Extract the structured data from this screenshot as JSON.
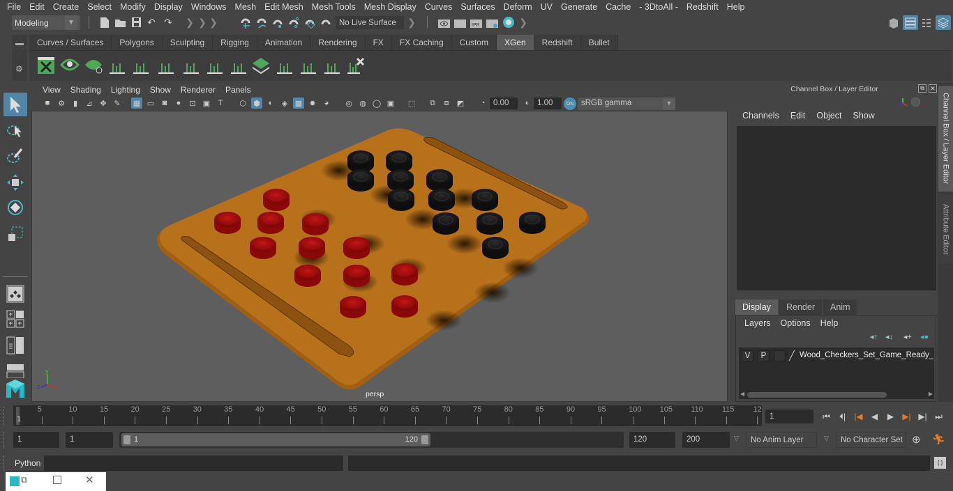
{
  "menubar": [
    "File",
    "Edit",
    "Create",
    "Select",
    "Modify",
    "Display",
    "Windows",
    "Mesh",
    "Edit Mesh",
    "Mesh Tools",
    "Mesh Display",
    "Curves",
    "Surfaces",
    "Deform",
    "UV",
    "Generate",
    "Cache",
    "- 3DtoAll -",
    "Redshift",
    "Help"
  ],
  "statusline": {
    "mode": "Modeling",
    "live_surface": "No Live Surface",
    "render_icons": [
      "render-view-icon",
      "render-current-frame-icon",
      "ipr-render-icon",
      "render-settings-icon",
      "hypershade-icon"
    ],
    "ipr_label": "IPR"
  },
  "shelf": {
    "tabs": [
      "Curves / Surfaces",
      "Polygons",
      "Sculpting",
      "Rigging",
      "Animation",
      "Rendering",
      "FX",
      "FX Caching",
      "Custom",
      "XGen",
      "Redshift",
      "Bullet"
    ],
    "active_tab": "XGen",
    "icons": [
      "xgen-editor-icon",
      "xgen-visibility-icon",
      "xgen-hide-icon",
      "xgen-add-guide-icon",
      "xgen-sculpt-guide-icon",
      "xgen-add-guide-2-icon",
      "xgen-show-guide-icon",
      "xgen-lock-guide-icon",
      "xgen-guides-icon",
      "xgen-density-icon",
      "xgen-flip-icon",
      "xgen-select-icon",
      "xgen-bound-icon",
      "xgen-delete-icon"
    ]
  },
  "panel": {
    "menus": [
      "View",
      "Shading",
      "Lighting",
      "Show",
      "Renderer",
      "Panels"
    ],
    "exposure": "0.00",
    "gamma": "1.00",
    "color_mgmt": "ON",
    "color_space": "sRGB gamma",
    "camera_label": "persp",
    "axis": {
      "x": "x",
      "y": "y",
      "z": "z"
    }
  },
  "scene": {
    "board_color": "#b8711b",
    "red_pieces": 12,
    "black_pieces": 12
  },
  "channel_box": {
    "title": "Channel Box / Layer Editor",
    "menus": [
      "Channels",
      "Edit",
      "Object",
      "Show"
    ]
  },
  "layer_editor": {
    "tabs": [
      "Display",
      "Render",
      "Anim"
    ],
    "active_tab": "Display",
    "menus": [
      "Layers",
      "Options",
      "Help"
    ],
    "layers": [
      {
        "v": "V",
        "p": "P",
        "name": "Wood_Checkers_Set_Game_Ready_layer"
      }
    ]
  },
  "side_tabs": [
    "Channel Box / Layer Editor",
    "Attribute Editor"
  ],
  "timeline": {
    "ticks": [
      "5",
      "10",
      "15",
      "20",
      "25",
      "30",
      "35",
      "40",
      "45",
      "50",
      "55",
      "60",
      "65",
      "70",
      "75",
      "80",
      "85",
      "90",
      "95",
      "100",
      "105",
      "110",
      "115",
      "12"
    ],
    "current_frame_marker": "1",
    "current_frame": "1"
  },
  "range": {
    "start": "1",
    "playback_start": "1",
    "slider_min": "1",
    "slider_max": "120",
    "playback_end": "120",
    "end": "200",
    "anim_layer": "No Anim Layer",
    "character_set": "No Character Set"
  },
  "command_line": {
    "label": "Python",
    "value": "",
    "result": ""
  }
}
